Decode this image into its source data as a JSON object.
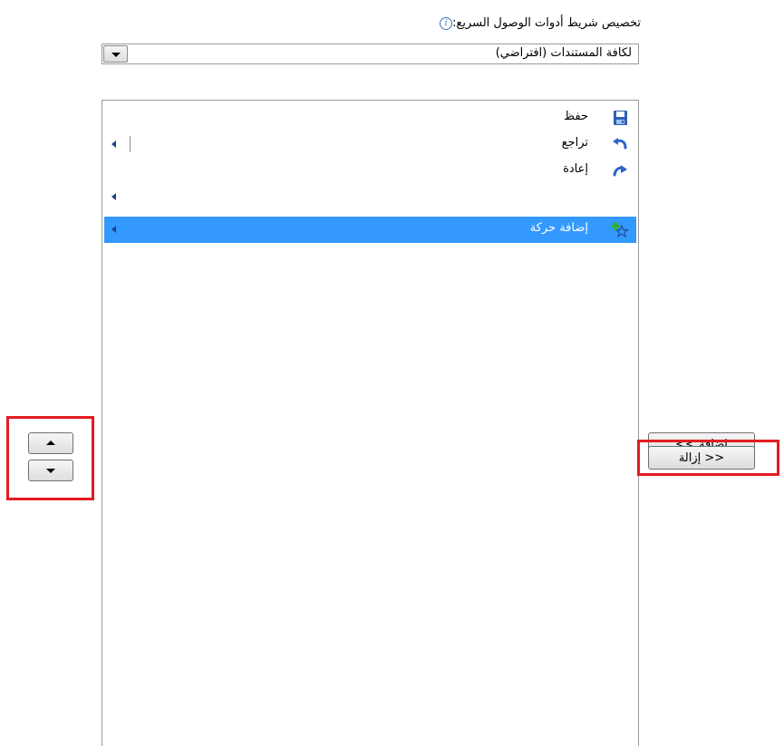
{
  "heading": {
    "text": "تخصيص شريط أدوات الوصول السريع:",
    "info_icon": "info-icon"
  },
  "scope_dropdown": {
    "selected": "لكافة المستندات (افتراضي)"
  },
  "toolbar_list": {
    "items": [
      {
        "label": "حفظ",
        "icon": "save-icon",
        "has_submenu": false,
        "selected": false
      },
      {
        "label": "تراجع",
        "icon": "undo-icon",
        "has_submenu": true,
        "selected": false
      },
      {
        "label": "إعادة",
        "icon": "redo-icon",
        "has_submenu": false,
        "selected": false
      },
      {
        "label": "",
        "icon": "",
        "has_submenu": true,
        "selected": false
      },
      {
        "label": "إضافة حركة",
        "icon": "add-animation-icon",
        "has_submenu": true,
        "selected": true
      }
    ]
  },
  "buttons": {
    "add_label": "إضافة >>",
    "remove_label": "<< إزالة",
    "move_up": "chevron-up-icon",
    "move_down": "chevron-down-icon"
  },
  "colors": {
    "selection": "#3399ff",
    "highlight_box": "#e31b23"
  }
}
